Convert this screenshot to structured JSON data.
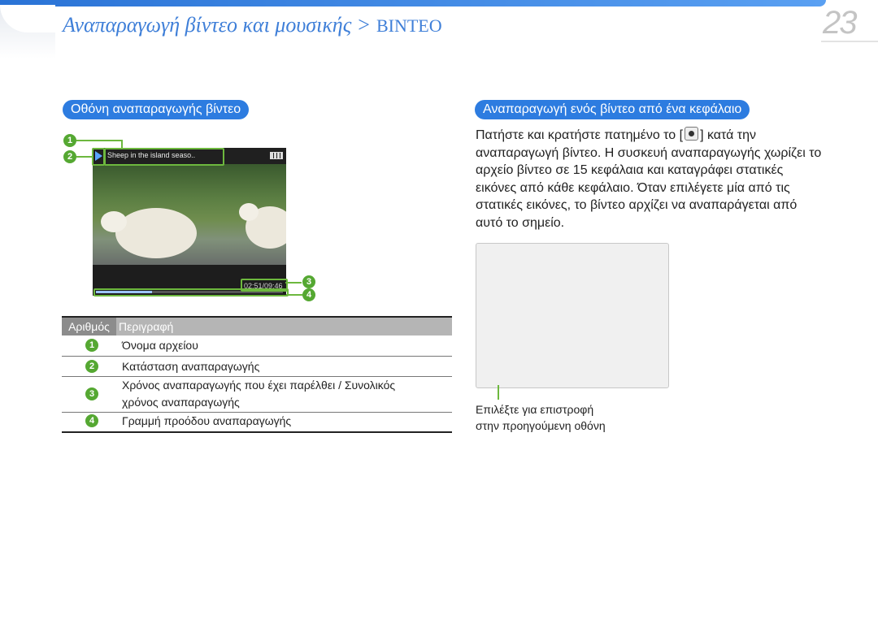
{
  "header": {
    "title": "Αναπαραγωγή βίντεο και μουσικής",
    "separator": ">",
    "section": "ΒΙΝΤΕΟ",
    "page_number": "23",
    "accent_color": "#3f7fd8"
  },
  "left": {
    "heading": "Οθόνη αναπαραγωγής βίντεο",
    "screenshot": {
      "file_name": "Sheep in the island seaso..",
      "time": "02:51/09:46",
      "progress_fraction": 0.3
    },
    "callouts": [
      "1",
      "2",
      "3",
      "4"
    ],
    "table": {
      "col_number": "Αριθμός",
      "col_description": "Περιγραφή",
      "rows": [
        {
          "num": "1",
          "desc": "Όνομα αρχείου"
        },
        {
          "num": "2",
          "desc": "Κατάσταση αναπαραγωγής"
        },
        {
          "num": "3",
          "desc": "Χρόνος αναπαραγωγής που έχει παρέλθει / Συνολικός χρόνος αναπαραγωγής"
        },
        {
          "num": "4",
          "desc": "Γραμμή προόδου αναπαραγωγής"
        }
      ]
    }
  },
  "right": {
    "heading": "Αναπαραγωγή ενός βίντεο από ένα κεφάλαιο",
    "para_before": "Πατήστε και κρατήστε πατημένο το [",
    "key_icon": "record-button-icon",
    "para_after": "] κατά την αναπαραγωγή βίντεο. Η συσκευή αναπαραγωγής χωρίζει το αρχείο βίντεο σε 15 κεφάλαια και καταγράφει στατικές εικόνες από κάθε κεφάλαιο. Όταν επιλέγετε μία από τις στατικές εικόνες, το βίντεο αρχίζει να αναπαράγεται από αυτό το σημείο.",
    "caption": "Επιλέξτε για επιστροφή\nστην προηγούμενη οθόνη"
  }
}
